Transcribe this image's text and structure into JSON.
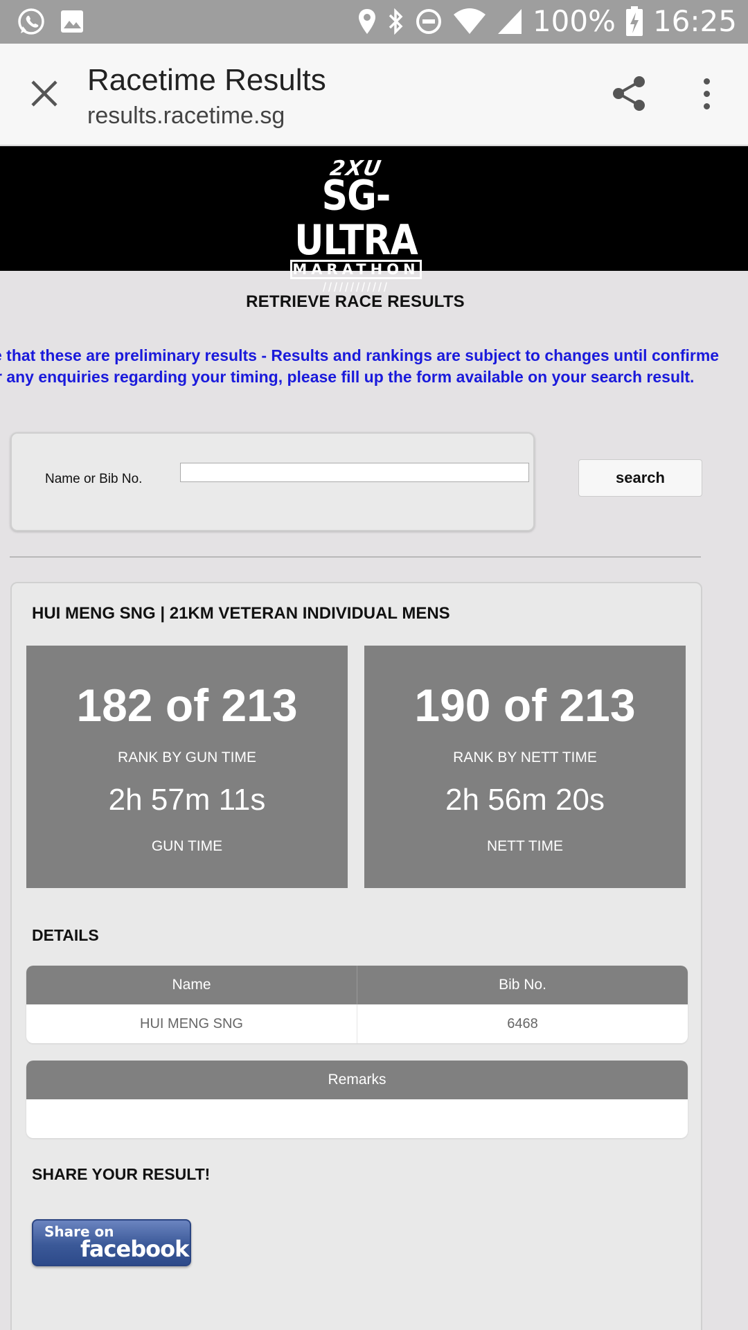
{
  "status_bar": {
    "battery": "100%",
    "time": "16:25",
    "icons": [
      "whatsapp-icon",
      "image-icon",
      "location-icon",
      "bluetooth-icon",
      "do-not-disturb-icon",
      "wifi-icon",
      "signal-icon",
      "battery-charging-icon"
    ]
  },
  "browser": {
    "title": "Racetime Results",
    "url": "results.racetime.sg"
  },
  "logo": {
    "brand": "2XU",
    "event": "SG-ULTRA",
    "sub": "MARATHON",
    "ticks": "////////////"
  },
  "page": {
    "title": "RETRIEVE RACE RESULTS",
    "notice_line1": "e that these are preliminary results - Results and rankings are subject to changes until confirme",
    "notice_line2": "r any enquiries regarding your timing, please fill up the form available on your search result."
  },
  "search": {
    "label": "Name or Bib No.",
    "value": "",
    "placeholder": "",
    "button": "search"
  },
  "result": {
    "heading": "HUI MENG SNG | 21KM VETERAN INDIVIDUAL MENS",
    "gun": {
      "rank": "182 of 213",
      "rank_caption": "RANK BY GUN TIME",
      "time": "2h 57m 11s",
      "time_caption": "GUN TIME"
    },
    "nett": {
      "rank": "190 of 213",
      "rank_caption": "RANK BY NETT TIME",
      "time": "2h 56m 20s",
      "time_caption": "NETT TIME"
    },
    "details_heading": "DETAILS",
    "details_columns": [
      "Name",
      "Bib No."
    ],
    "details_values": [
      "HUI MENG SNG",
      "6468"
    ],
    "remarks_header": "Remarks",
    "remarks_value": "",
    "share_heading": "SHARE YOUR RESULT!",
    "share_small": "Share on",
    "share_large": "facebook"
  },
  "colors": {
    "notice": "#1a1adb",
    "rank_box": "#808080",
    "banner": "#000000",
    "facebook": "#3b5998"
  }
}
